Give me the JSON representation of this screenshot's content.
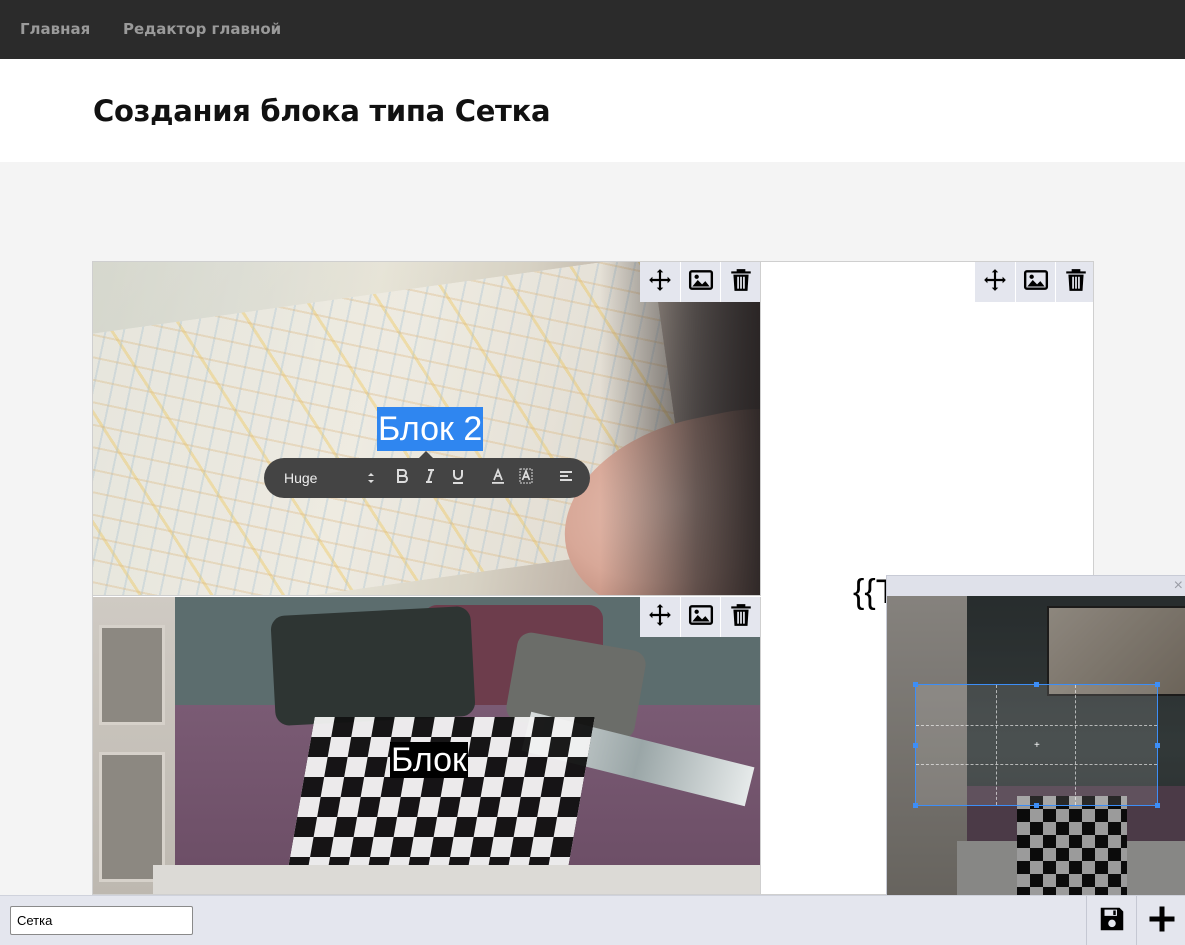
{
  "nav": {
    "home": "Главная",
    "editor": "Редактор главной"
  },
  "header": {
    "title": "Создания блока типа Сетка"
  },
  "grid": {
    "cells": [
      {
        "text": "Блок 2",
        "text_style": "selected"
      },
      {
        "text": "Блок",
        "text_style": "highlighted"
      },
      {
        "text": "{{T",
        "text_style": "plain"
      }
    ],
    "toolbar_icons": [
      "move-icon",
      "image-icon",
      "trash-icon"
    ]
  },
  "editor_toolbar": {
    "size": "Huge",
    "buttons": [
      "bold-icon",
      "italic-icon",
      "underline-icon",
      "text-color-icon",
      "background-color-icon",
      "align-icon"
    ]
  },
  "cropper": {
    "close_label": "×"
  },
  "bottom": {
    "name_value": "Сетка",
    "save_icon": "save-icon",
    "add_icon": "plus-icon"
  },
  "colors": {
    "nav_bg": "#2b2b2b",
    "selection": "#2f86f0",
    "toolbar_bg": "#e4e6ee",
    "bubble_bg": "#444444",
    "crop_border": "#3d8ef7"
  }
}
